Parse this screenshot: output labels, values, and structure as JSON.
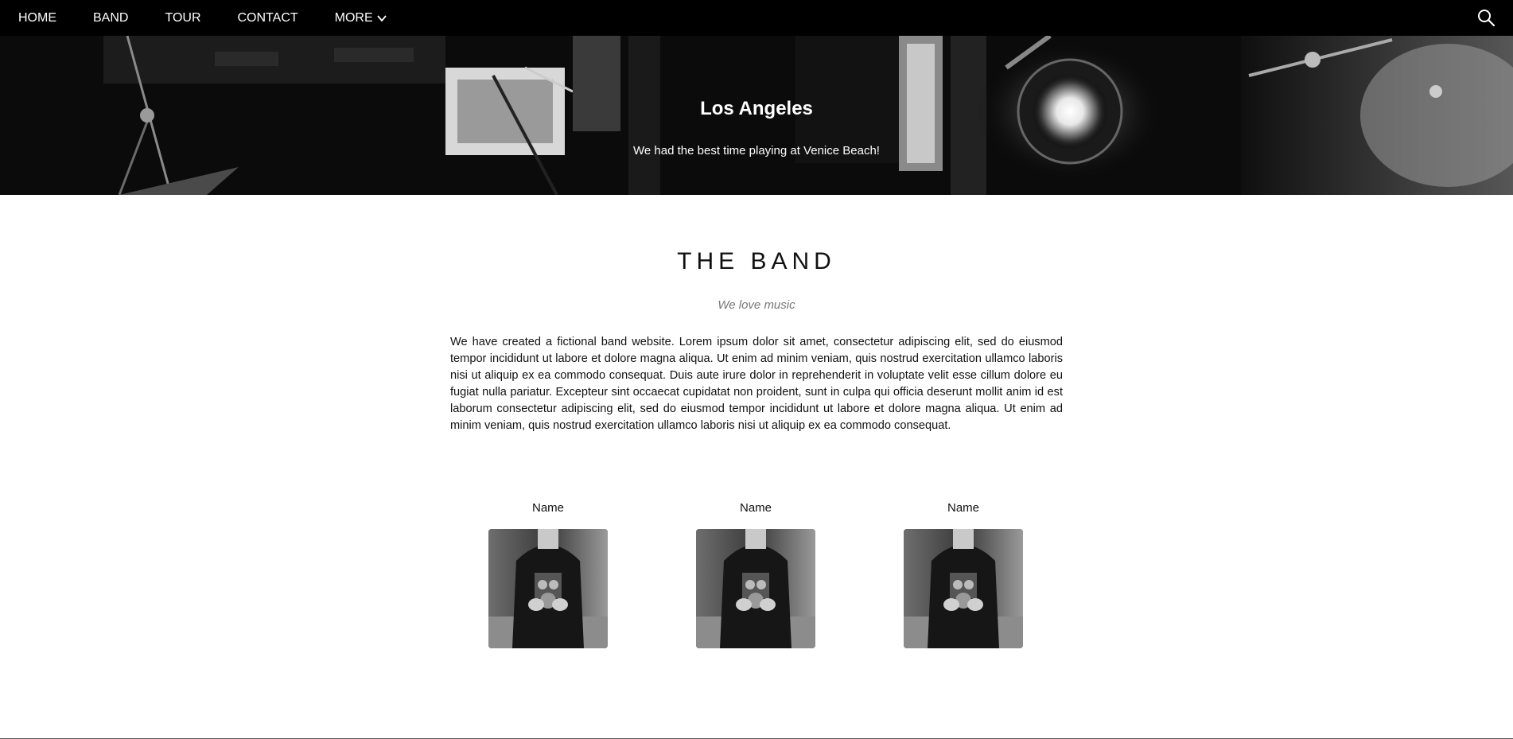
{
  "nav": {
    "items": [
      "HOME",
      "BAND",
      "TOUR",
      "CONTACT"
    ],
    "more_label": "MORE",
    "more_icon": "chevron-down-icon",
    "search_icon": "search-icon"
  },
  "hero": {
    "title": "Los Angeles",
    "caption": "We had the best time playing at Venice Beach!"
  },
  "band": {
    "title": "THE BAND",
    "subtitle": "We love music",
    "body": "We have created a fictional band website. Lorem ipsum dolor sit amet, consectetur adipiscing elit, sed do eiusmod tempor incididunt ut labore et dolore magna aliqua. Ut enim ad minim veniam, quis nostrud exercitation ullamco laboris nisi ut aliquip ex ea commodo consequat. Duis aute irure dolor in reprehenderit in voluptate velit esse cillum dolore eu fugiat nulla pariatur. Excepteur sint occaecat cupidatat non proident, sunt in culpa qui officia deserunt mollit anim id est laborum consectetur adipiscing elit, sed do eiusmod tempor incididunt ut labore et dolore magna aliqua. Ut enim ad minim veniam, quis nostrud exercitation ullamco laboris nisi ut aliquip ex ea commodo consequat.",
    "members": [
      {
        "name": "Name"
      },
      {
        "name": "Name"
      },
      {
        "name": "Name"
      }
    ]
  },
  "colors": {
    "nav_bg": "#000000",
    "hero_bg": "#0b0b0b",
    "text": "#111111",
    "subtitle": "#777777"
  }
}
